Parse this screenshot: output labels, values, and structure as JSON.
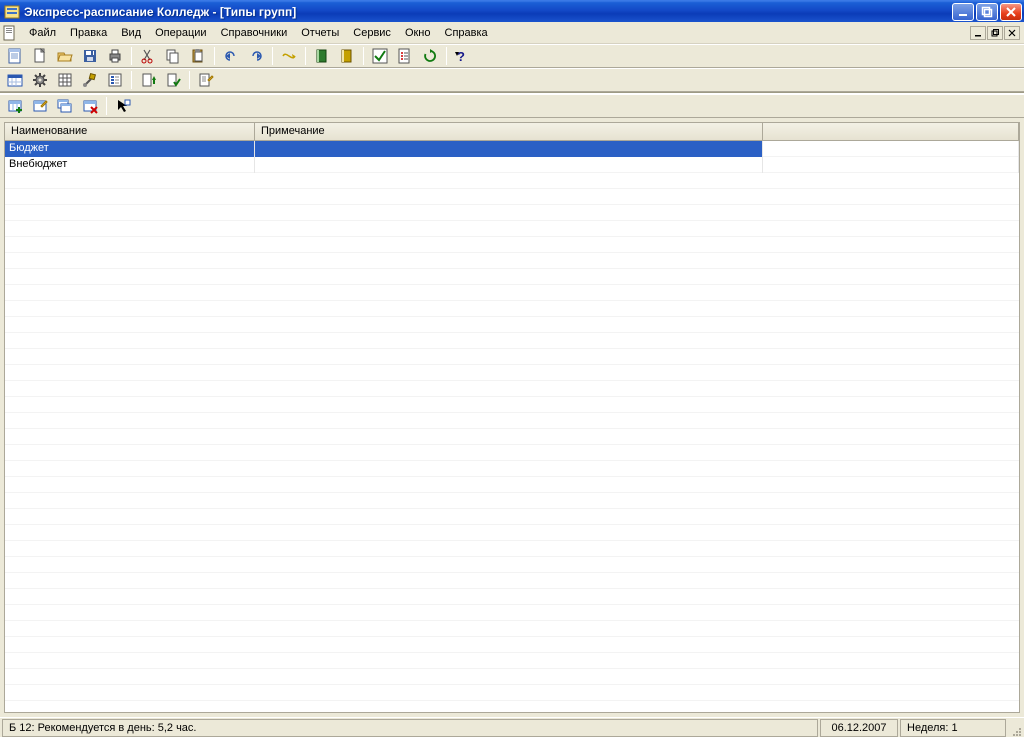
{
  "title": "Экспресс-расписание Колледж - [Типы групп]",
  "menu": {
    "items": [
      "Файл",
      "Правка",
      "Вид",
      "Операции",
      "Справочники",
      "Отчеты",
      "Сервис",
      "Окно",
      "Справка"
    ]
  },
  "toolbar1_icons": [
    "sheet-icon",
    "new-icon",
    "open-icon",
    "save-icon",
    "print-icon",
    "sep",
    "cut-icon",
    "copy-icon",
    "paste-icon",
    "sep",
    "undo-icon",
    "redo-icon",
    "sep",
    "execute-icon",
    "sep",
    "book1-icon",
    "book2-icon",
    "sep",
    "check-icon",
    "task-icon",
    "refresh-icon",
    "sep",
    "help-icon"
  ],
  "toolbar2_icons": [
    "calendar-icon",
    "gear-icon",
    "grid-icon",
    "tools-icon",
    "props-icon",
    "sep",
    "doc-up-icon",
    "doc-check-icon",
    "sep",
    "edit-doc-icon"
  ],
  "child_toolbar_icons": [
    "add-icon",
    "edit-icon",
    "copy-row-icon",
    "delete-icon",
    "sep",
    "pick-icon"
  ],
  "grid": {
    "columns": {
      "name": "Наименование",
      "note": "Примечание"
    },
    "rows": [
      {
        "name": "Бюджет",
        "note": "",
        "selected": true
      },
      {
        "name": "Внебюджет",
        "note": "",
        "selected": false
      }
    ]
  },
  "status": {
    "main": "Б 12: Рекомендуется в день: 5,2 час.",
    "date": "06.12.2007",
    "week": "Неделя: 1"
  }
}
